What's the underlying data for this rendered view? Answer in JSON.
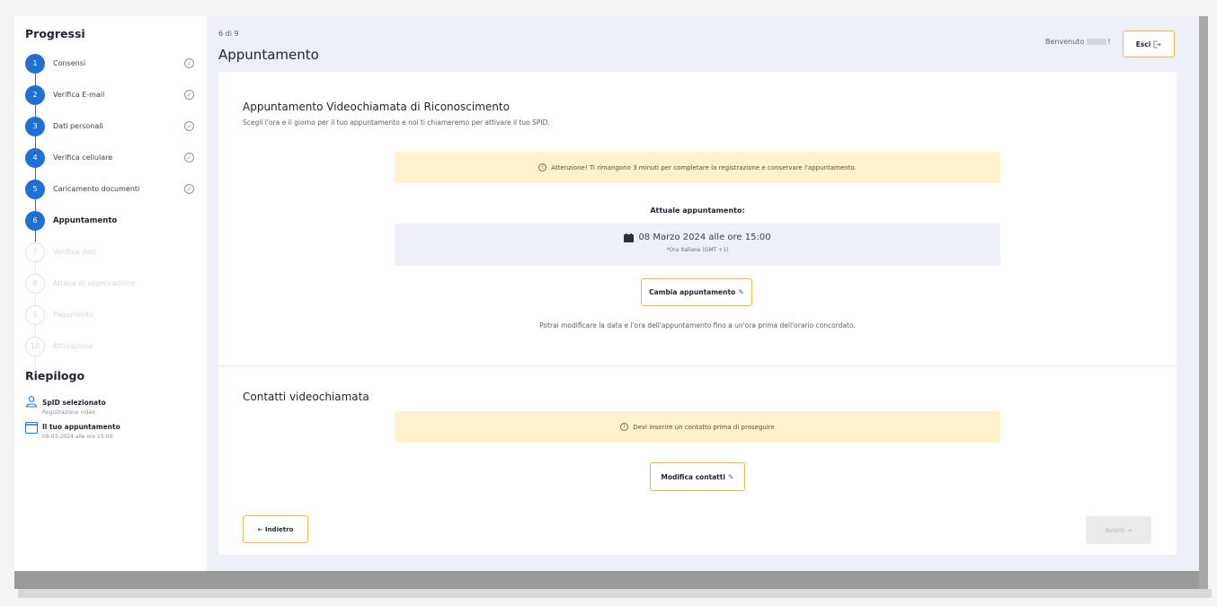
{
  "sidebar": {
    "progress_title": "Progressi",
    "steps": [
      {
        "num": "1",
        "label": "Consensi",
        "status": "done"
      },
      {
        "num": "2",
        "label": "Verifica E-mail",
        "status": "done"
      },
      {
        "num": "3",
        "label": "Dati personali",
        "status": "done"
      },
      {
        "num": "4",
        "label": "Verifica cellulare",
        "status": "done"
      },
      {
        "num": "5",
        "label": "Caricamento documenti",
        "status": "done"
      },
      {
        "num": "6",
        "label": "Appuntamento",
        "status": "active"
      },
      {
        "num": "7",
        "label": "Verifica dati",
        "status": "pending"
      },
      {
        "num": "8",
        "label": "Attesa di approvazione",
        "status": "pending"
      },
      {
        "num": "9",
        "label": "Pagamento",
        "status": "pending"
      },
      {
        "num": "10",
        "label": "Attivazione",
        "status": "pending"
      }
    ],
    "summary_title": "Riepilogo",
    "summary": [
      {
        "title": "SpID selezionato",
        "subtitle": "Registrazione video",
        "icon": "user-icon"
      },
      {
        "title": "Il tuo appuntamento",
        "subtitle": "08-03-2024 alle ore 15:00",
        "icon": "calendar-icon"
      }
    ]
  },
  "header": {
    "counter": "6 di 9",
    "title": "Appuntamento",
    "welcome_prefix": "Benvenuto",
    "welcome_suffix": "!",
    "exit_label": "Esci",
    "exit_icon": "logout-icon"
  },
  "appointment": {
    "title": "Appuntamento Videochiamata di Riconoscimento",
    "subtitle": "Scegli l'ora e il giorno per il tuo appuntamento e noi ti chiameremo per attivare il tuo SPID.",
    "warning": "Attenzione! Ti rimangono 3 minuti per completare la registrazione e conservare l'appuntamento.",
    "current_label": "Attuale appuntamento:",
    "date": "08 Marzo 2024 alle ore 15:00",
    "timezone": "*Ora Italiana (GMT +1)",
    "change_label": "Cambia appuntamento",
    "note": "Potrai modificare la data e l'ora dell'appuntamento fino a un'ora prima dell'orario concordato."
  },
  "contacts": {
    "title": "Contatti videochiamata",
    "warning": "Devi inserire un contatto prima di proseguire",
    "edit_label": "Modifica contatti"
  },
  "nav": {
    "back_label": "← Indietro",
    "next_label": "Avanti →"
  },
  "colors": {
    "accent_blue": "#1f6fd6",
    "button_border": "#e9b949",
    "alert_bg": "#fdf2cc",
    "page_bg": "#eef0f7"
  }
}
